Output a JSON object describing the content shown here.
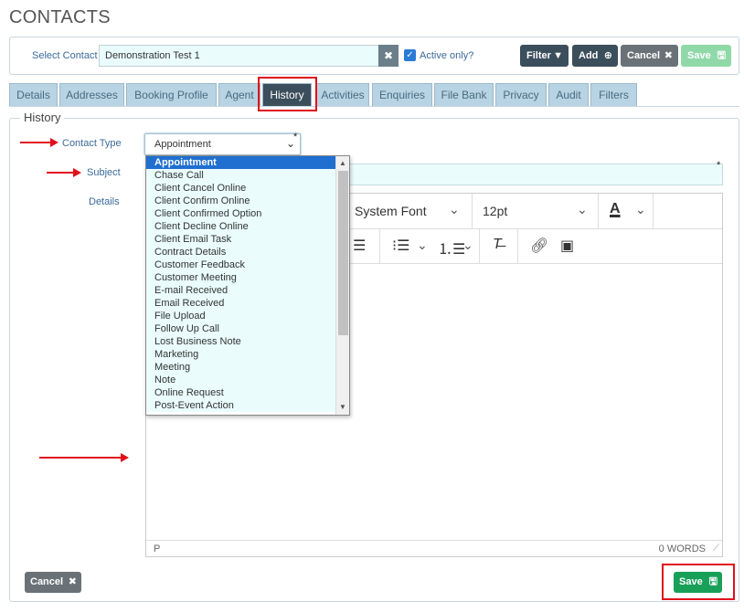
{
  "page": {
    "title": "CONTACTS"
  },
  "contact_bar": {
    "select_label": "Select Contact",
    "contact_value": "Demonstration Test 1",
    "clear_icon": "close-icon",
    "active_only_label": "Active only?",
    "active_only_checked": true,
    "filter_label": "Filter",
    "add_label": "Add",
    "cancel_label": "Cancel",
    "save_label": "Save"
  },
  "tabs": [
    {
      "label": "Details"
    },
    {
      "label": "Addresses"
    },
    {
      "label": "Booking Profile"
    },
    {
      "label": "Agent"
    },
    {
      "label": "History",
      "active": true
    },
    {
      "label": "Activities"
    },
    {
      "label": "Enquiries"
    },
    {
      "label": "File Bank"
    },
    {
      "label": "Privacy"
    },
    {
      "label": "Audit"
    },
    {
      "label": "Filters"
    }
  ],
  "history": {
    "legend": "History",
    "contact_type_label": "Contact Type",
    "contact_type_value": "Appointment",
    "subject_label": "Subject",
    "details_label": "Details",
    "required_marker": "*"
  },
  "editor": {
    "font_family": "System Font",
    "font_size": "12pt",
    "status_element": "P",
    "word_count": "0 WORDS"
  },
  "dropdown": {
    "options": [
      "Appointment",
      "Chase Call",
      "Client Cancel Online",
      "Client Confirm Online",
      "Client Confirmed Option",
      "Client Decline Online",
      "Client Email Task",
      "Contract Details",
      "Customer Feedback",
      "Customer Meeting",
      "E-mail Received",
      "Email Received",
      "File Upload",
      "Follow Up Call",
      "Lost Business Note",
      "Marketing",
      "Meeting",
      "Note",
      "Online Request",
      "Post-Event Action"
    ],
    "selected": "Appointment"
  },
  "footer": {
    "cancel_label": "Cancel",
    "save_label": "Save"
  },
  "colors": {
    "accent_dark": "#3b4e5c",
    "save_green": "#18a058",
    "highlight_red": "#e0101a",
    "input_bg": "#eafcfc"
  }
}
